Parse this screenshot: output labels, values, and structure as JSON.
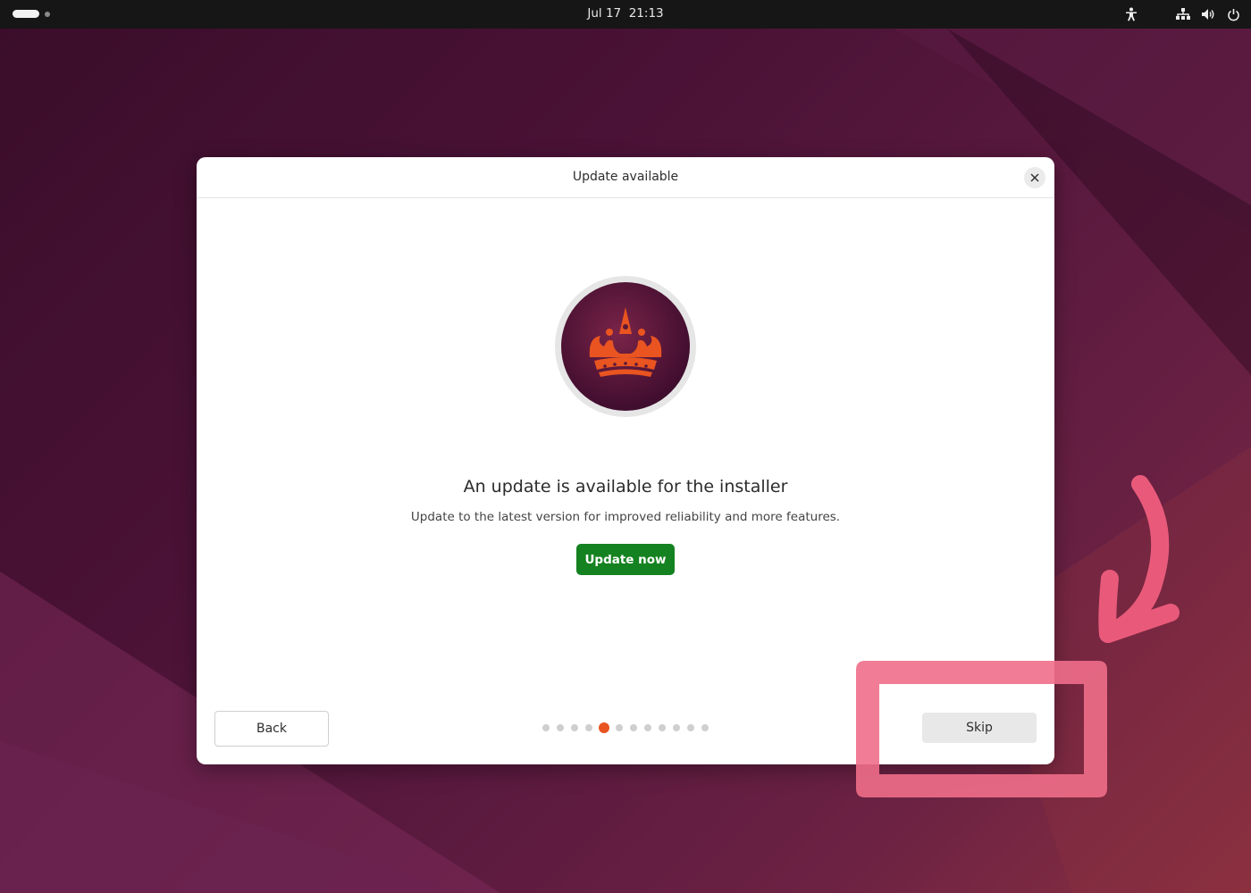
{
  "topbar": {
    "clock": "Jul 17  21:13",
    "tray_icons": [
      "accessibility-icon",
      "network-icon",
      "volume-icon",
      "power-icon"
    ]
  },
  "dialog": {
    "title": "Update available",
    "heading": "An update is available for the installer",
    "subtext": "Update to the latest version for improved reliability and more features.",
    "update_button": "Update now",
    "back_button": "Back",
    "skip_button": "Skip",
    "close_icon": "close-icon",
    "pager": {
      "total": 12,
      "current": 5
    }
  },
  "colors": {
    "accent": "#e95420",
    "update_button": "#158221",
    "highlight": "#f06e8a",
    "topbar": "#161616"
  }
}
